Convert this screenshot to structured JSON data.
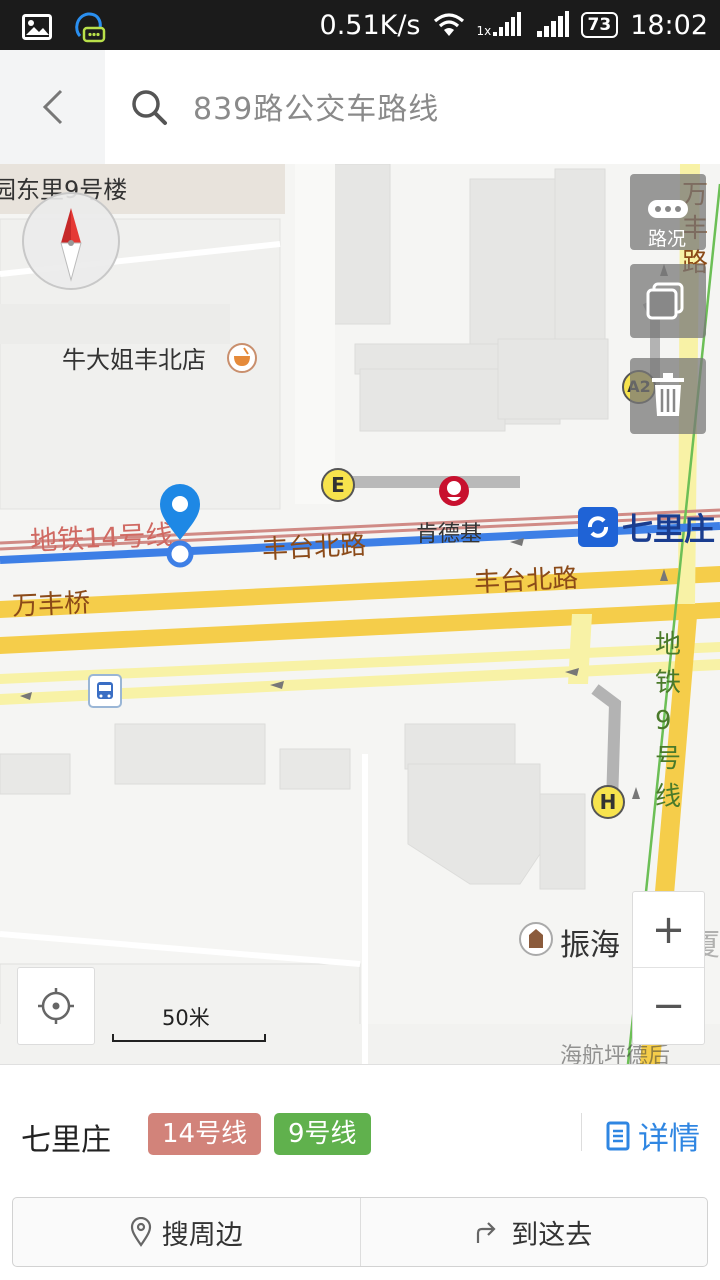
{
  "status_bar": {
    "speed": "0.51K/s",
    "sim_label": "1x",
    "battery": "73",
    "time": "18:02"
  },
  "search": {
    "query": "839路公交车路线"
  },
  "map": {
    "labels": {
      "building_top": "园东里9号楼",
      "restaurant": "牛大姐丰北店",
      "kfc": "肯德基",
      "metro_14": "地铁14号线",
      "road_fengtai_1": "丰台北路",
      "road_fengtai_2": "丰台北路",
      "road_wanfeng": "万丰桥",
      "road_wanfeng_v": "万丰路",
      "metro_9": "地铁9号线",
      "station": "七里庄",
      "zhenhai": "振海",
      "zhenhai_tail": "大厦",
      "bottom_cut": "海航坪德后"
    },
    "exits": {
      "e": "E",
      "a": "A2",
      "h": "H"
    },
    "traffic_label": "路况",
    "scale_label": "50米",
    "zoom_in": "+",
    "zoom_out": "−"
  },
  "station_panel": {
    "name": "七里庄",
    "lines": [
      {
        "label": "14号线",
        "color": "#d2837a"
      },
      {
        "label": "9号线",
        "color": "#60b14d"
      }
    ],
    "details_label": "详情",
    "search_nearby": "搜周边",
    "go_here": "到这去"
  }
}
